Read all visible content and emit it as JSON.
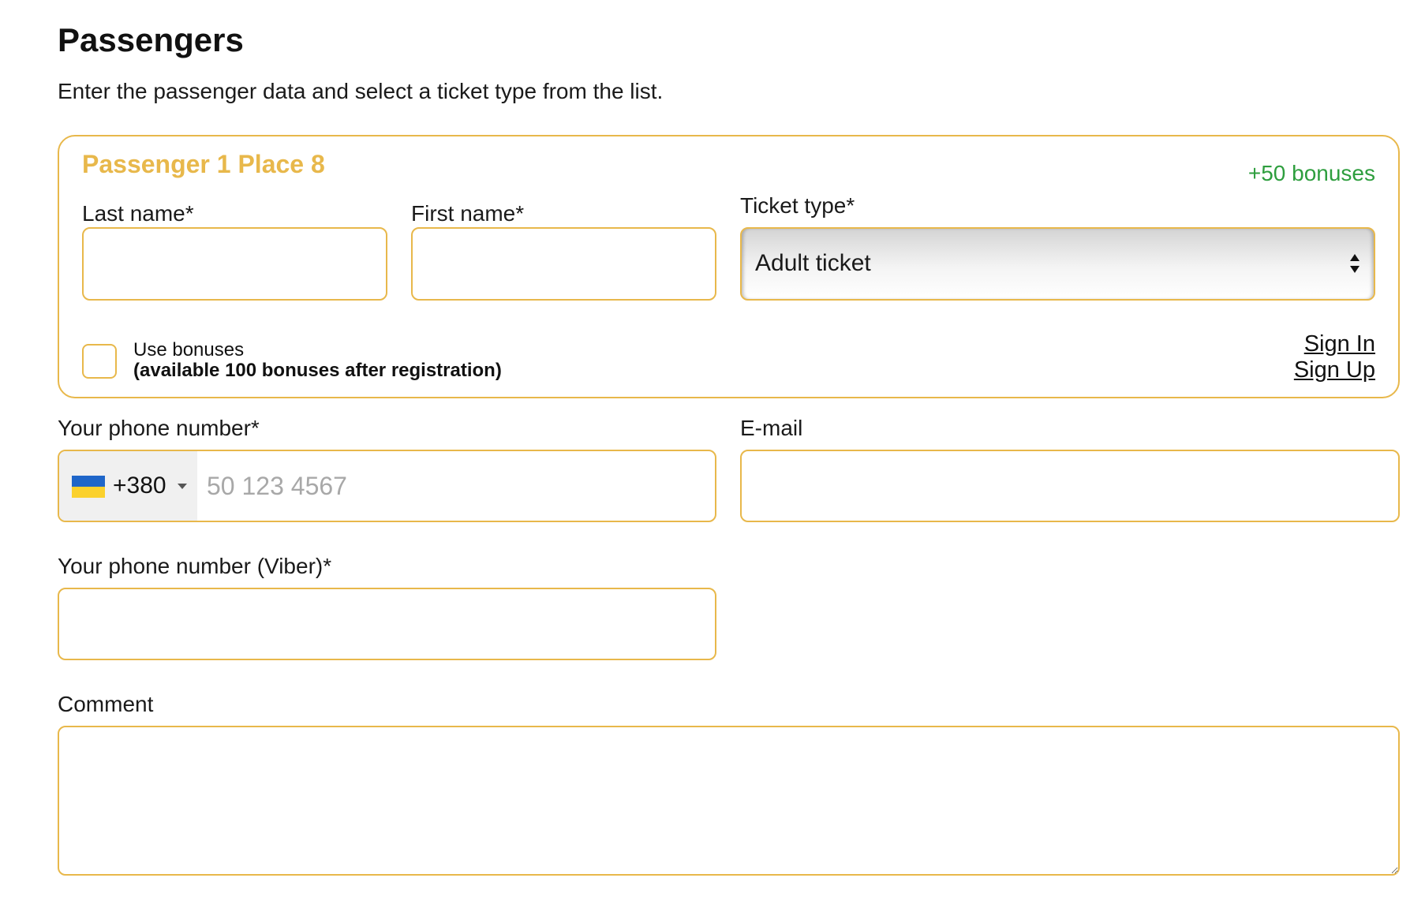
{
  "header": {
    "title": "Passengers",
    "subtitle": "Enter the passenger data and select a ticket type from the list."
  },
  "passenger": {
    "title": "Passenger 1 Place 8",
    "bonus_earn": "+50 bonuses",
    "last_name_label": "Last name*",
    "last_name_value": "",
    "first_name_label": "First name*",
    "first_name_value": "",
    "ticket_type_label": "Ticket type*",
    "ticket_type_value": "Adult ticket",
    "use_bonuses_label": "Use bonuses",
    "use_bonuses_note": "(available 100 bonuses after registration)",
    "use_bonuses_checked": false,
    "sign_in": "Sign In",
    "sign_up": "Sign Up"
  },
  "contact": {
    "phone_label": "Your phone number*",
    "phone_country_code": "+380",
    "phone_country_flag": "ukraine-flag-icon",
    "phone_placeholder": "50 123 4567",
    "phone_value": "",
    "email_label": "E-mail",
    "email_value": "",
    "viber_label": "Your phone number (Viber)*",
    "viber_value": "",
    "comment_label": "Comment",
    "comment_value": ""
  },
  "colors": {
    "accent": "#e8b84b",
    "bonus_green": "#2e9e3e",
    "flag_blue": "#1f66c9",
    "flag_yellow": "#fbd12d"
  }
}
